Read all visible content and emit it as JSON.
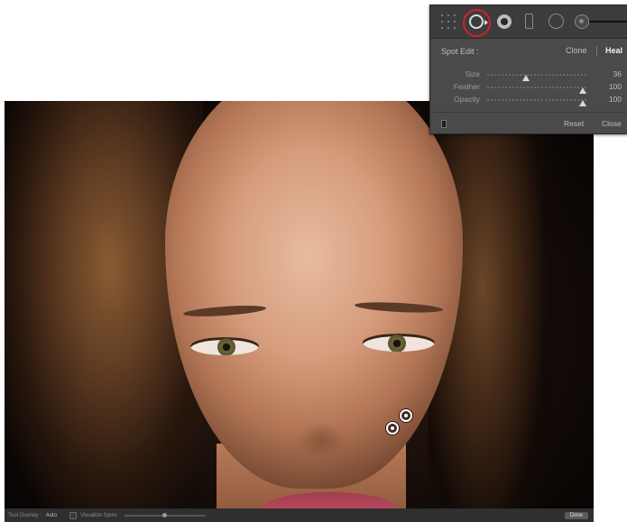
{
  "spot_panel": {
    "title": "Spot Edit :",
    "modes": {
      "clone": "Clone",
      "heal": "Heal",
      "active": "Heal"
    },
    "sliders": [
      {
        "label": "Size",
        "value": "36",
        "fraction": 0.38
      },
      {
        "label": "Feather",
        "value": "100",
        "fraction": 1.0
      },
      {
        "label": "Opacity",
        "value": "100",
        "fraction": 1.0
      }
    ],
    "reset_label": "Reset",
    "close_label": "Close",
    "tools": [
      "grid-icon",
      "spot-removal-icon",
      "red-eye-icon",
      "graduated-filter-icon",
      "radial-filter-icon",
      "adjustment-brush-icon"
    ],
    "highlight_color": "#d2202a"
  },
  "toolbar": {
    "overlay_label": "Tool Overlay :",
    "overlay_value": "Auto",
    "visualize_label": "Visualize Spots",
    "done_label": "Done"
  }
}
